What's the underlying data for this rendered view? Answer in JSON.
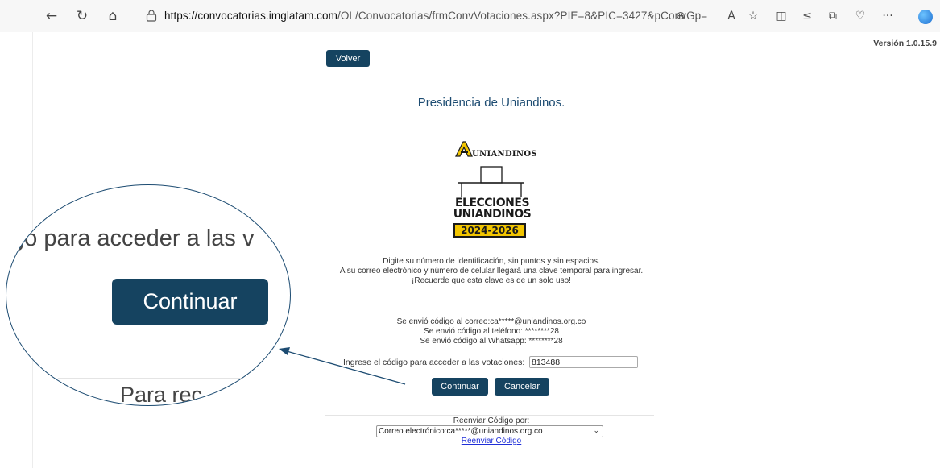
{
  "browser": {
    "url_domain": "https://convocatorias.imglatam.com",
    "url_path": "/OL/Convocatorias/frmConvVotaciones.aspx?PIE=8&PIC=3427&pConvGp=",
    "icons": [
      "back-icon",
      "refresh-icon",
      "home-icon",
      "lock-icon",
      "zoom-icon",
      "read-aloud-icon",
      "favorite-icon",
      "split-screen-icon",
      "favorites-list-icon",
      "collections-icon",
      "health-icon",
      "more-icon",
      "profile-icon"
    ],
    "more_label": "···"
  },
  "page": {
    "version": "Versión 1.0.15.9",
    "back_button": "Volver",
    "title": "Presidencia de Uniandinos.",
    "logo_text": "UNIANDINOS",
    "elections_line1": "ELECCIONES",
    "elections_line2": "UNIANDINOS",
    "elections_years": "2024-2026",
    "instructions": [
      "Digite su número de identificación, sin puntos y sin espacios.",
      "A su correo electrónico y número de celular llegará una clave temporal para ingresar.",
      "¡Recuerde que esta clave es de un solo uso!"
    ],
    "sent_messages": [
      "Se envió código al correo:ca*****@uniandinos.org.co",
      "Se envió código al teléfono: ********28",
      "Se envió código al Whatsapp: ********28"
    ],
    "code_label": "Ingrese el código para acceder a las votaciones:",
    "code_value": "813488",
    "continue_button": "Continuar",
    "cancel_button": "Cancelar",
    "resend_label": "Reenviar Código por:",
    "resend_selected": "Correo electrónico:ca*****@uniandinos.org.co",
    "resend_link": "Reenviar Código"
  },
  "magnifier": {
    "text_line1": "go para acceder a las v",
    "button": "Continuar",
    "text_line2": "Para rec"
  },
  "colors": {
    "primary": "#154360",
    "title": "#1d4c72",
    "badge": "#f2c500",
    "link": "#1f2fd8"
  }
}
